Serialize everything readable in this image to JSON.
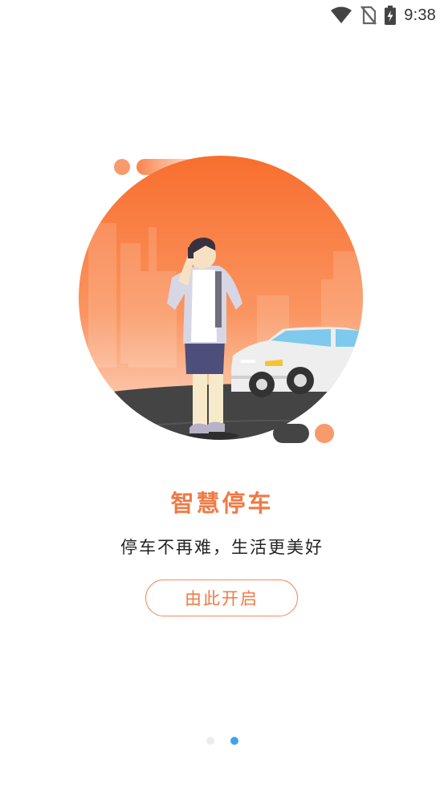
{
  "status_bar": {
    "time": "9:38",
    "icons": [
      "wifi-icon",
      "no-sim-icon",
      "battery-charging-icon"
    ]
  },
  "onboarding": {
    "illustration": "person-on-phone-walking-with-car-icon",
    "title": "智慧停车",
    "subtitle": "停车不再难，生活更美好",
    "button_label": "由此开启"
  },
  "pager": {
    "total_pages": 2,
    "active_page": 2
  },
  "colors": {
    "accent": "#f07a45",
    "title": "#f07a45",
    "button_border": "#f28a5e",
    "pager_active": "#3fa3f2",
    "pager_inactive": "#ececec"
  }
}
